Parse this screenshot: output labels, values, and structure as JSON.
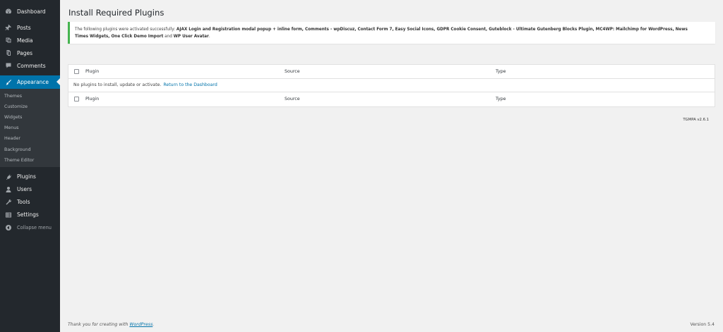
{
  "sidebar": {
    "top_items": [
      {
        "label": "Dashboard",
        "icon": "dashboard-icon"
      }
    ],
    "items": [
      {
        "label": "Posts",
        "icon": "pin-icon"
      },
      {
        "label": "Media",
        "icon": "media-icon"
      },
      {
        "label": "Pages",
        "icon": "page-icon"
      },
      {
        "label": "Comments",
        "icon": "comment-icon"
      }
    ],
    "appearance": {
      "label": "Appearance",
      "icon": "brush-icon"
    },
    "appearance_sub": [
      "Themes",
      "Customize",
      "Widgets",
      "Menus",
      "Header",
      "Background",
      "Theme Editor"
    ],
    "bottom_items": [
      {
        "label": "Plugins",
        "icon": "plug-icon"
      },
      {
        "label": "Users",
        "icon": "user-icon"
      },
      {
        "label": "Tools",
        "icon": "wrench-icon"
      },
      {
        "label": "Settings",
        "icon": "settings-icon"
      }
    ],
    "collapse": "Collapse menu"
  },
  "page": {
    "title": "Install Required Plugins"
  },
  "notice": {
    "prefix": "The following plugins were activated successfully:",
    "plugins_line1": "AJAX Login and Registration modal popup + inline form, Comments - wpDiscuz, Contact Form 7, Easy Social Icons, GDPR Cookie Consent, Guteblock - Ultimate Gutenberg Blocks Plugin, MC4WP: Mailchimp for WordPress, News",
    "plugins_line2": "Times Widgets, One Click Demo Import",
    "and": "and",
    "last_plugin": "WP User Avatar",
    "end": "."
  },
  "table": {
    "headers": {
      "plugin": "Plugin",
      "source": "Source",
      "type": "Type"
    },
    "empty_text": "No plugins to install, update or activate.",
    "return_link": "Return to the Dashboard"
  },
  "tgmpa_version": "TGMPA v2.6.1",
  "footer": {
    "thanks_prefix": "Thank you for creating with",
    "thanks_link": "WordPress",
    "thanks_suffix": ".",
    "version": "Version 5.4"
  },
  "colors": {
    "sidebar_bg": "#23282d",
    "submenu_bg": "#32373c",
    "accent": "#0073aa",
    "notice_border": "#46b450",
    "page_bg": "#f1f1f1"
  }
}
